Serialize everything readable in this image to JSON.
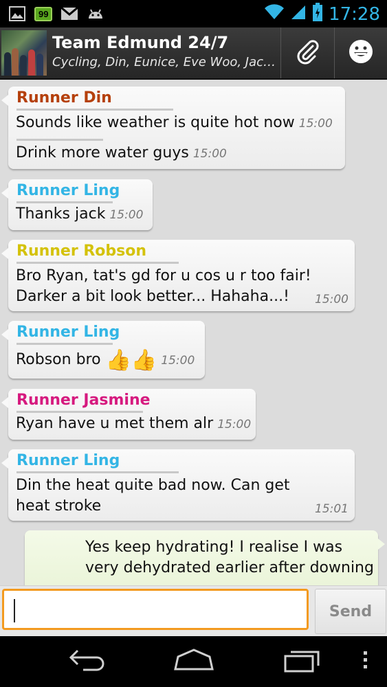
{
  "status_bar": {
    "battery_badge": "99",
    "time": "17:28",
    "icons": [
      "image-icon",
      "battery-badge-icon",
      "gmail-icon",
      "android-icon",
      "wifi-icon",
      "signal-icon",
      "battery-icon"
    ]
  },
  "header": {
    "title": "Team Edmund 24/7",
    "subtitle": "Cycling, Din, Eunice, Eve Woo, Jack, L..."
  },
  "messages": [
    {
      "sender": "Runner Din",
      "color": "#b5400c",
      "lines": [
        {
          "text": "Sounds like weather is quite hot now",
          "time": "15:00"
        },
        {
          "text": "Drink more water guys",
          "time": "15:00"
        }
      ]
    },
    {
      "sender": "Runner Ling",
      "color": "#33b5e5",
      "lines": [
        {
          "text": "Thanks jack",
          "time": "15:00"
        }
      ]
    },
    {
      "sender": "Runner Robson",
      "color": "#d4c20a",
      "text_line1": "Bro Ryan, tat's gd for u cos u r too fair!",
      "text_line2": "Darker a bit look better... Hahaha...!",
      "time": "15:00"
    },
    {
      "sender": "Runner Ling",
      "color": "#33b5e5",
      "text": "Robson bro",
      "emoji": "👍👍",
      "time": "15:00"
    },
    {
      "sender": "Runner Jasmine",
      "color": "#d61a7f",
      "text": "Ryan have u met them alr",
      "time": "15:00"
    },
    {
      "sender": "Runner Ling",
      "color": "#33b5e5",
      "text_line1": "Din the heat quite bad now. Can get",
      "text_line2": "heat stroke",
      "time": "15:01"
    }
  ],
  "outgoing": {
    "text_line1": "Yes keep hydrating! I realise I was",
    "text_line2": "very dehydrated earlier after downing"
  },
  "compose": {
    "value": "",
    "send_label": "Send"
  }
}
